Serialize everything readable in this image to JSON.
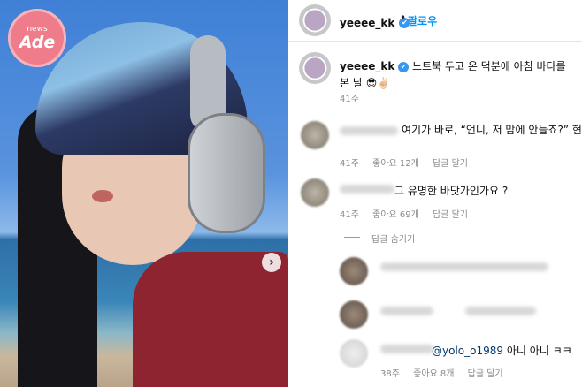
{
  "logo": {
    "small": "news",
    "big": "Ade"
  },
  "post": {
    "username": "yeeee_kk",
    "follow_label": "팔로우",
    "dot": "•",
    "caption": "노트북 두고 온 덕분에 아침 바다를 본 날 😎✌🏻",
    "caption_time": "41주"
  },
  "comments": [
    {
      "text": "여기가 바로, “언니, 저 맘에 안들죠?” 현장",
      "time": "41주",
      "likes": "좋아요 12개",
      "reply": "답글 달기"
    },
    {
      "text": "그 유명한 바닷가인가요 ?",
      "time": "41주",
      "likes": "좋아요 69개",
      "reply": "답글 달기"
    }
  ],
  "hide_replies": "답글 숨기기",
  "replies": [
    {
      "mention": "@yolo_o1989",
      "text": " 아니 아니 ㅋㅋ",
      "time": "38주",
      "likes": "좋아요 8개",
      "reply": "답글 달기"
    }
  ],
  "icons": {
    "verified": "✔",
    "next": "›",
    "heart": "♡"
  },
  "colors": {
    "accent": "#0095f6",
    "logo_pink": "#ef7c8a",
    "verified_blue": "#3897f0"
  }
}
